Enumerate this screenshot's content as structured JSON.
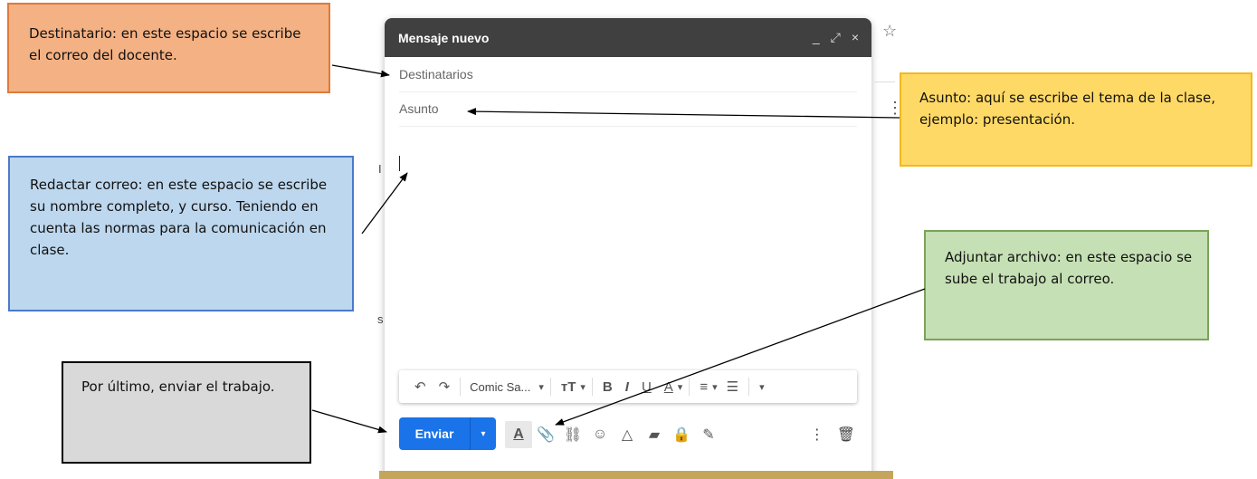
{
  "compose": {
    "title": "Mensaje nuevo",
    "header_buttons": {
      "minimize": "_",
      "expand": "⤢",
      "close": "×"
    },
    "recipients_placeholder": "Destinatarios",
    "subject_placeholder": "Asunto",
    "toolbar": {
      "undo": "↶",
      "redo": "↷",
      "font": "Comic Sa...",
      "font_dropdown": "▾",
      "size": "ᴛT",
      "size_dropdown": "▾",
      "bold": "B",
      "italic": "I",
      "underline": "U",
      "text_color": "A",
      "text_color_dropdown": "▾",
      "align": "≡",
      "align_dropdown": "▾",
      "numbered_list": "☰",
      "more": "▾"
    },
    "send_label": "Enviar",
    "send_dropdown": "▾",
    "bottom_icons": {
      "formatting": "A",
      "attach": "📎",
      "link": "⛓",
      "emoji": "☺",
      "drive": "△",
      "photo": "▰",
      "confidential": "🔒",
      "signature": "✎"
    },
    "more_options": "⋮",
    "discard": "🗑"
  },
  "background": {
    "star": "☆",
    "more": "⋮",
    "frag_i": "I",
    "frag_s": "s"
  },
  "annotations": {
    "destinatario": "Destinatario: en este espacio se escribe el correo del docente.",
    "asunto": "Asunto: aquí se escribe el tema de la clase, ejemplo: presentación.",
    "redactar": "Redactar correo: en este espacio se escribe su nombre completo, y curso. Teniendo en cuenta las normas para la comunicación en clase.",
    "adjuntar": "Adjuntar archivo: en este espacio se sube el trabajo al correo.",
    "enviar": "Por último, enviar el trabajo."
  },
  "colors": {
    "header": "#404040",
    "send": "#1a73e8",
    "box_orange": "#f4b183",
    "box_yellow": "#ffd966",
    "box_blue": "#bdd7ee",
    "box_green": "#c5e0b4",
    "box_gray": "#d9d9d9"
  }
}
